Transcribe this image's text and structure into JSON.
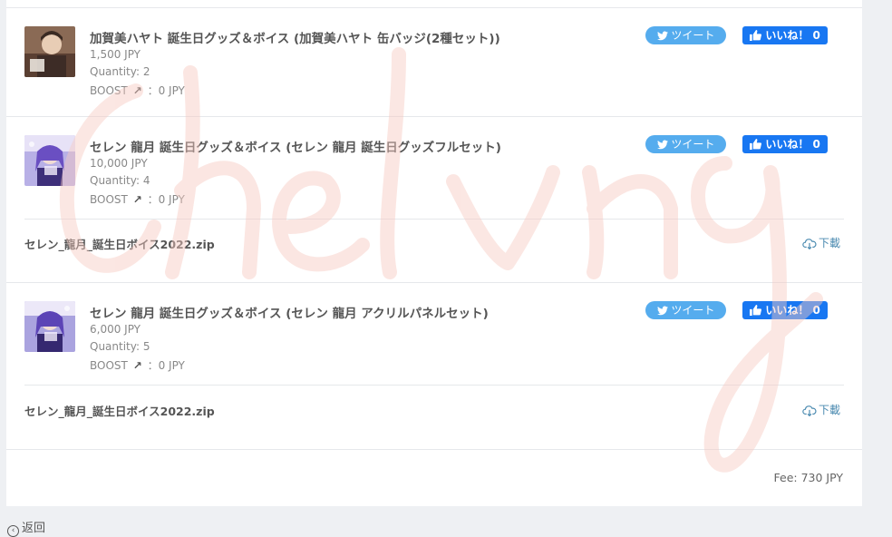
{
  "items": [
    {
      "title": "加賀美ハヤト 誕生日グッズ＆ボイス (加賀美ハヤト 缶バッジ(2種セット))",
      "price": "1,500 JPY",
      "quantity": "Quantity: 2",
      "boost_label": "BOOST",
      "boost_value": "：0 JPY",
      "tweet_label": "ツイート",
      "like_label": "いいね！ 0"
    },
    {
      "title": "セレン 龍月 誕生日グッズ＆ボイス (セレン 龍月 誕生日グッズフルセット)",
      "price": "10,000 JPY",
      "quantity": "Quantity: 4",
      "boost_label": "BOOST",
      "boost_value": "：0 JPY",
      "tweet_label": "ツイート",
      "like_label": "いいね！ 0",
      "file": "セレン_龍月_誕生日ボイス2022.zip",
      "download_label": "下載"
    },
    {
      "title": "セレン 龍月 誕生日グッズ＆ボイス (セレン 龍月 アクリルパネルセット)",
      "price": "6,000 JPY",
      "quantity": "Quantity: 5",
      "boost_label": "BOOST",
      "boost_value": "：0 JPY",
      "tweet_label": "ツイート",
      "like_label": "いいね！ 0",
      "file": "セレン_龍月_誕生日ボイス2022.zip",
      "download_label": "下載"
    }
  ],
  "fee": "Fee: 730 JPY",
  "back_label": "返回",
  "icons": {
    "tweet": "twitter-bird-icon",
    "like": "thumbs-up-icon",
    "download": "cloud-download-icon",
    "boost": "arrow-up-right-icon",
    "back": "circle-arrow-left-icon"
  },
  "colors": {
    "tweet": "#55acee",
    "like": "#1877f2",
    "download": "#4a8ab0",
    "watermark": "#f7c9c0"
  }
}
